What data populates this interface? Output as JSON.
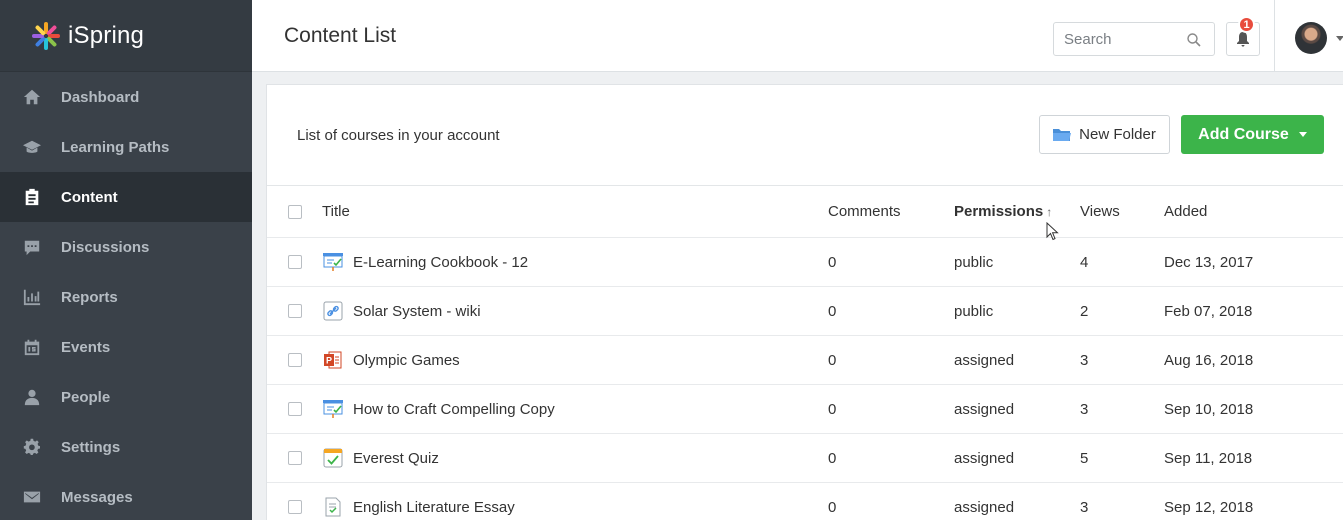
{
  "brand": {
    "name": "iSpring"
  },
  "sidebar": {
    "items": [
      {
        "label": "Dashboard",
        "icon": "home-icon",
        "active": false
      },
      {
        "label": "Learning Paths",
        "icon": "graduation-cap-icon",
        "active": false
      },
      {
        "label": "Content",
        "icon": "clipboard-icon",
        "active": true
      },
      {
        "label": "Discussions",
        "icon": "chat-icon",
        "active": false
      },
      {
        "label": "Reports",
        "icon": "bar-chart-icon",
        "active": false
      },
      {
        "label": "Events",
        "icon": "calendar-icon",
        "active": false
      },
      {
        "label": "People",
        "icon": "person-icon",
        "active": false
      },
      {
        "label": "Settings",
        "icon": "gear-icon",
        "active": false
      },
      {
        "label": "Messages",
        "icon": "envelope-icon",
        "active": false
      }
    ]
  },
  "header": {
    "title": "Content List",
    "search_placeholder": "Search",
    "notification_count": "1"
  },
  "panel": {
    "subtitle": "List of courses in your account",
    "new_folder_label": "New Folder",
    "add_course_label": "Add Course"
  },
  "table": {
    "columns": {
      "title": "Title",
      "comments": "Comments",
      "permissions": "Permissions",
      "views": "Views",
      "added": "Added"
    },
    "sort_indicator": "↑",
    "rows": [
      {
        "title": "E-Learning Cookbook - 12",
        "icon": "presentation-icon",
        "comments": "0",
        "permissions": "public",
        "views": "4",
        "added": "Dec 13, 2017"
      },
      {
        "title": "Solar System - wiki",
        "icon": "link-icon",
        "comments": "0",
        "permissions": "public",
        "views": "2",
        "added": "Feb 07, 2018"
      },
      {
        "title": "Olympic Games",
        "icon": "powerpoint-icon",
        "comments": "0",
        "permissions": "assigned",
        "views": "3",
        "added": "Aug 16, 2018"
      },
      {
        "title": "How to Craft Compelling Copy",
        "icon": "presentation-icon",
        "comments": "0",
        "permissions": "assigned",
        "views": "3",
        "added": "Sep 10, 2018"
      },
      {
        "title": "Everest Quiz",
        "icon": "quiz-icon",
        "comments": "0",
        "permissions": "assigned",
        "views": "5",
        "added": "Sep 11, 2018"
      },
      {
        "title": "English Literature Essay",
        "icon": "document-icon",
        "comments": "0",
        "permissions": "assigned",
        "views": "3",
        "added": "Sep 12, 2018"
      }
    ]
  },
  "colors": {
    "sidebar_bg": "#3a4149",
    "sidebar_active": "#2a3036",
    "accent_green": "#3cb44a",
    "badge_red": "#e84c3d"
  }
}
